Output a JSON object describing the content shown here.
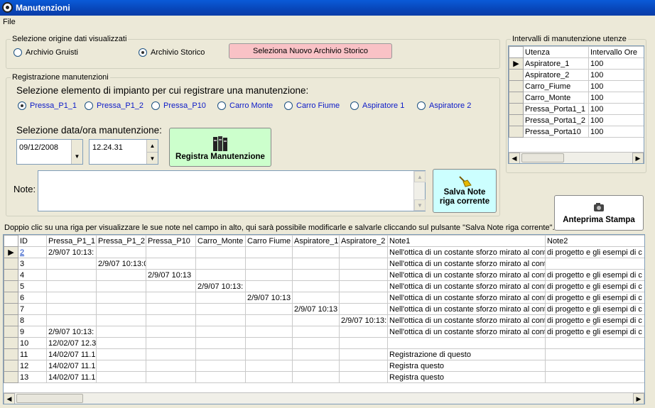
{
  "window": {
    "title": "Manutenzioni"
  },
  "menu": {
    "file": "File"
  },
  "origin": {
    "legend": "Selezione origine dati visualizzati",
    "option1": "Archivio Gruisti",
    "option2": "Archivio Storico",
    "select_button": "Seleziona Nuovo Archivio Storico"
  },
  "registration": {
    "legend": "Registrazione manutenzioni",
    "element_label": "Selezione elemento di impianto per cui registrare una manutenzione:",
    "elements": [
      "Pressa_P1_1",
      "Pressa_P1_2",
      "Pressa_P10",
      "Carro Monte",
      "Carro Fiume",
      "Aspiratore 1",
      "Aspiratore 2"
    ],
    "date_label": "Selezione data/ora manutenzione:",
    "date_value": "09/12/2008",
    "time_value": "12.24.31",
    "register_button": "Registra Manutenzione",
    "note_label": "Note:",
    "save_note_button_line1": "Salva Note",
    "save_note_button_line2": "riga corrente"
  },
  "intervals": {
    "legend": "Intervalli di manutenzione utenze",
    "headers": [
      "Utenza",
      "Intervallo Ore"
    ],
    "rows": [
      [
        "Aspiratore_1",
        "100"
      ],
      [
        "Aspiratore_2",
        "100"
      ],
      [
        "Carro_Fiume",
        "100"
      ],
      [
        "Carro_Monte",
        "100"
      ],
      [
        "Pressa_Porta1_1",
        "100"
      ],
      [
        "Pressa_Porta1_2",
        "100"
      ],
      [
        "Pressa_Porta10",
        "100"
      ]
    ]
  },
  "print_button": "Anteprima Stampa",
  "instructions": "Doppio clic su una riga per visualizzare le sue note nel campo in alto, qui sarà possibile modificarle e salvarle cliccando sul pulsante \"Salva Note riga corrente\".",
  "main_table": {
    "headers": [
      "ID",
      "Pressa_P1_1",
      "Pressa_P1_2",
      "Pressa_P10",
      "Carro_Monte",
      "Carro Fiume",
      "Aspiratore_1",
      "Aspiratore_2",
      "Note1",
      "Note2"
    ],
    "rows": [
      [
        "2",
        "2/9/07 10:13:",
        "",
        "",
        "",
        "",
        "",
        "",
        "Nell'ottica di un costante sforzo mirato al contin",
        "di progetto e gli esempi di c"
      ],
      [
        "3",
        "",
        "2/9/07 10:13:0",
        "",
        "",
        "",
        "",
        "",
        "Nell'ottica di un costante sforzo mirato al contin",
        ""
      ],
      [
        "4",
        "",
        "",
        "2/9/07 10:13",
        "",
        "",
        "",
        "",
        "Nell'ottica di un costante sforzo mirato al contin",
        "di progetto e gli esempi di c"
      ],
      [
        "5",
        "",
        "",
        "",
        "2/9/07 10:13:",
        "",
        "",
        "",
        "Nell'ottica di un costante sforzo mirato al contin",
        "di progetto e gli esempi di c"
      ],
      [
        "6",
        "",
        "",
        "",
        "",
        "2/9/07 10:13",
        "",
        "",
        "Nell'ottica di un costante sforzo mirato al contin",
        "di progetto e gli esempi di c"
      ],
      [
        "7",
        "",
        "",
        "",
        "",
        "",
        "2/9/07 10:13",
        "",
        "Nell'ottica di un costante sforzo mirato al contin",
        "di progetto e gli esempi di c"
      ],
      [
        "8",
        "",
        "",
        "",
        "",
        "",
        "",
        "2/9/07 10:13:",
        "Nell'ottica di un costante sforzo mirato al contin",
        "di progetto e gli esempi di c"
      ],
      [
        "9",
        "2/9/07 10:13:",
        "",
        "",
        "",
        "",
        "",
        "",
        "Nell'ottica di un costante sforzo mirato al contin",
        "di progetto e gli esempi di c"
      ],
      [
        "10",
        "12/02/07 12.3",
        "",
        "",
        "",
        "",
        "",
        "",
        "",
        ""
      ],
      [
        "11",
        "14/02/07 11.1",
        "",
        "",
        "",
        "",
        "",
        "",
        "Registrazione di questo",
        ""
      ],
      [
        "12",
        "14/02/07 11.1",
        "",
        "",
        "",
        "",
        "",
        "",
        "Registra questo",
        ""
      ],
      [
        "13",
        "14/02/07 11.1",
        "",
        "",
        "",
        "",
        "",
        "",
        "Registra questo",
        ""
      ]
    ]
  }
}
